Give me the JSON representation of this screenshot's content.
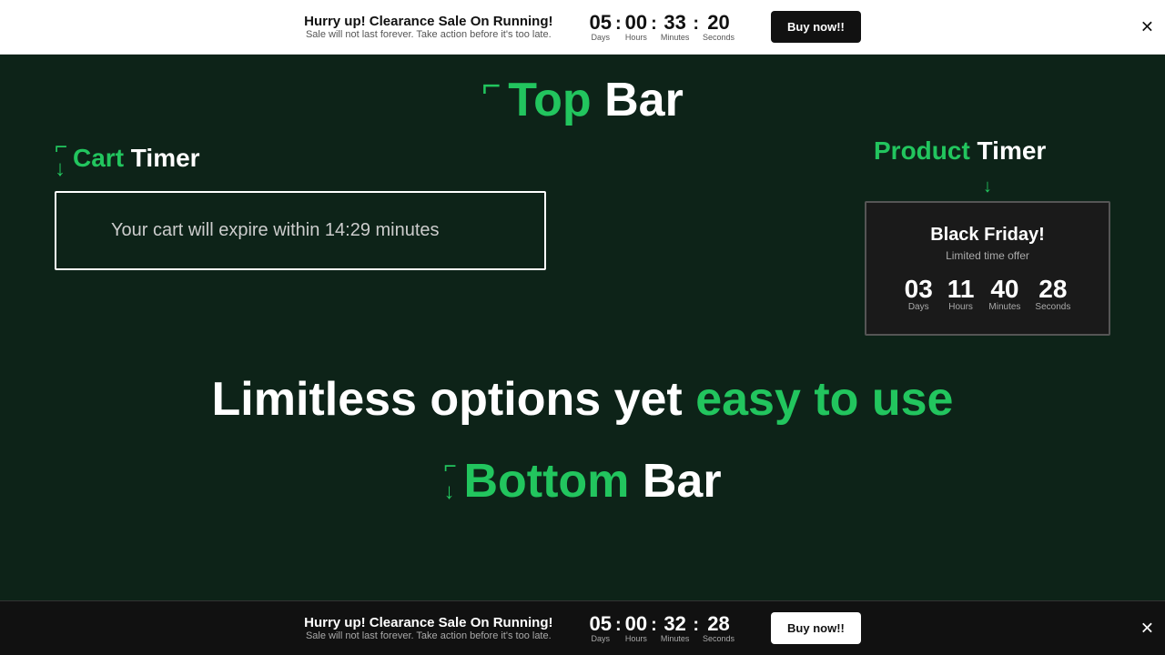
{
  "topBar": {
    "title": "Hurry up! Clearance Sale On Running!",
    "subtitle": "Sale will not last forever. Take action before it's too late.",
    "countdown": {
      "days": "05",
      "hours": "00",
      "minutes": "33",
      "seconds": "20",
      "days_label": "Days",
      "hours_label": "Hours",
      "minutes_label": "Minutes",
      "seconds_label": "Seconds"
    },
    "button": "Buy now!!"
  },
  "bottomBar": {
    "title": "Hurry up! Clearance Sale On Running!",
    "subtitle": "Sale will not last forever. Take action before it's too late.",
    "countdown": {
      "days": "05",
      "hours": "00",
      "minutes": "32",
      "seconds": "28",
      "days_label": "Days",
      "hours_label": "Hours",
      "minutes_label": "Minutes",
      "seconds_label": "Seconds"
    },
    "button": "Buy now!!"
  },
  "topBarLabel": {
    "green": "Top",
    "white": " Bar"
  },
  "cartTimer": {
    "label_green": "Cart",
    "label_white": " Timer",
    "text": "Your cart  will expire within 14:29 minutes"
  },
  "productTimer": {
    "label_green": "Product",
    "label_white": " Timer",
    "title": "Black Friday!",
    "subtitle": "Limited time offer",
    "countdown": {
      "days": "03",
      "hours": "11",
      "minutes": "40",
      "seconds": "28",
      "days_label": "Days",
      "hours_label": "Hours",
      "minutes_label": "Minutes",
      "seconds_label": "Seconds"
    }
  },
  "limitless": {
    "part1": "Limitless options yet",
    "part2": " easy to use"
  },
  "bottomBarLabel": {
    "green": "Bottom",
    "white": " Bar"
  }
}
